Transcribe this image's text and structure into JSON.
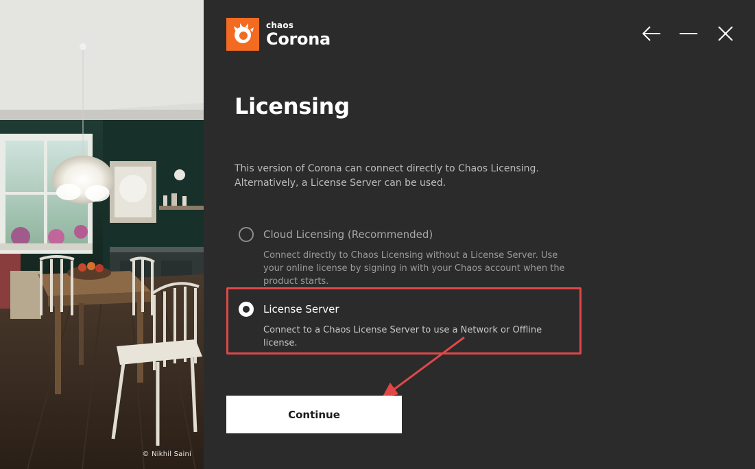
{
  "window": {
    "brand": "chaos",
    "product": "Corona",
    "controls": {
      "back_icon": "arrow-left-icon",
      "minimize_icon": "minimize-icon",
      "close_icon": "close-icon"
    }
  },
  "hero": {
    "credit": "© Nikhil Saini"
  },
  "page": {
    "title": "Licensing",
    "intro": "This version of Corona can connect directly to Chaos Licensing. Alternatively, a License Server can be used."
  },
  "options": [
    {
      "label": "Cloud Licensing (Recommended)",
      "description": "Connect directly to Chaos Licensing without a License Server. Use your online license by signing in with your Chaos account when the product starts.",
      "selected": false
    },
    {
      "label": "License Server",
      "description": "Connect to a Chaos License Server to use a Network or Offline license.",
      "selected": true
    }
  ],
  "actions": {
    "continue_label": "Continue"
  },
  "colors": {
    "accent": "#f26b21",
    "background": "#2b2b2b",
    "annotation": "#e04848",
    "button": "#ffffff"
  }
}
